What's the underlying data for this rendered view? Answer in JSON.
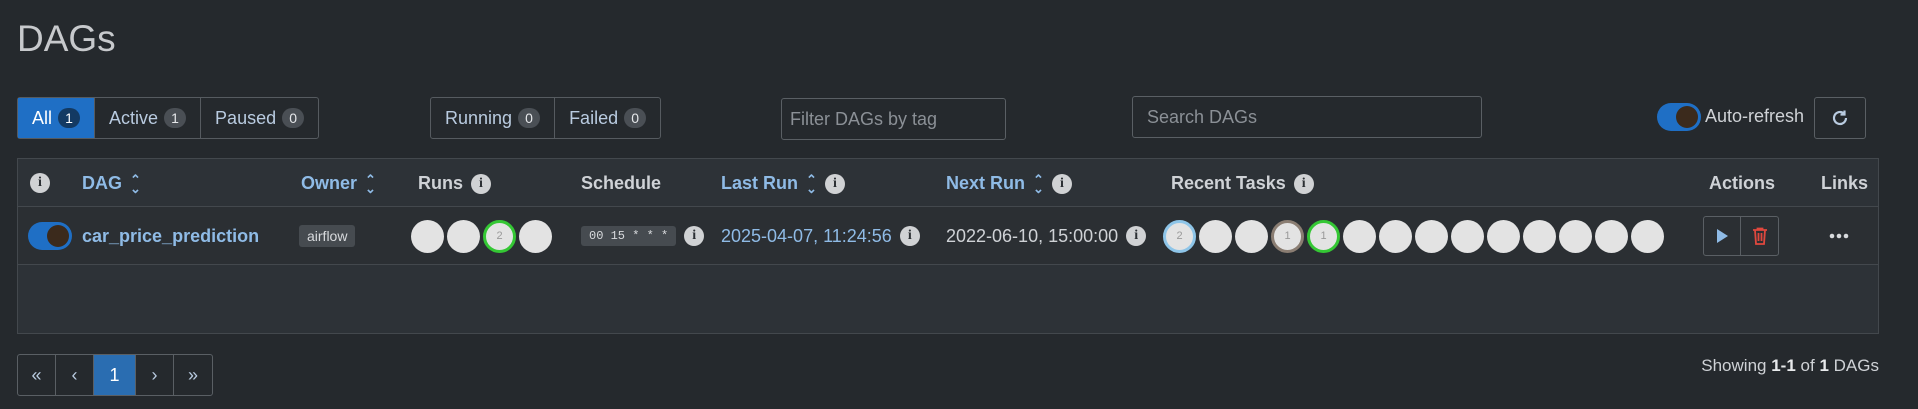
{
  "page": {
    "title": "DAGs"
  },
  "filters": {
    "status": [
      {
        "label": "All",
        "count": "1"
      },
      {
        "label": "Active",
        "count": "1"
      },
      {
        "label": "Paused",
        "count": "0"
      }
    ],
    "state": [
      {
        "label": "Running",
        "count": "0"
      },
      {
        "label": "Failed",
        "count": "0"
      }
    ],
    "tag_placeholder": "Filter DAGs by tag",
    "search_placeholder": "Search DAGs",
    "auto_refresh_label": "Auto-refresh"
  },
  "table": {
    "headers": {
      "dag": "DAG",
      "owner": "Owner",
      "runs": "Runs",
      "schedule": "Schedule",
      "last_run": "Last Run",
      "next_run": "Next Run",
      "recent_tasks": "Recent Tasks",
      "actions": "Actions",
      "links": "Links"
    },
    "rows": [
      {
        "dag_id": "car_price_prediction",
        "owner": "airflow",
        "schedule": "00 15 * * *",
        "last_run": "2025-04-07, 11:24:56",
        "next_run": "2022-06-10, 15:00:00",
        "runs": [
          {
            "count": "",
            "border": ""
          },
          {
            "count": "",
            "border": ""
          },
          {
            "count": "2",
            "border": "#34c734"
          },
          {
            "count": "",
            "border": ""
          }
        ],
        "recent_tasks": [
          {
            "count": "2",
            "border": "#8ec5e8"
          },
          {
            "count": "",
            "border": ""
          },
          {
            "count": "",
            "border": ""
          },
          {
            "count": "1",
            "border": "#8a7d72"
          },
          {
            "count": "1",
            "border": "#34c734"
          },
          {
            "count": "",
            "border": ""
          },
          {
            "count": "",
            "border": ""
          },
          {
            "count": "",
            "border": ""
          },
          {
            "count": "",
            "border": ""
          },
          {
            "count": "",
            "border": ""
          },
          {
            "count": "",
            "border": ""
          },
          {
            "count": "",
            "border": ""
          },
          {
            "count": "",
            "border": ""
          },
          {
            "count": "",
            "border": ""
          }
        ]
      }
    ]
  },
  "pagination": {
    "first": "«",
    "prev": "‹",
    "current": "1",
    "next": "›",
    "last": "»"
  },
  "footer": {
    "showing_prefix": "Showing",
    "range": "1-1",
    "of": "of",
    "total": "1",
    "suffix": "DAGs"
  },
  "colors": {
    "accent": "#1f6fc5",
    "link": "#8fbbe6",
    "success": "#34c734",
    "delete": "#e0483e"
  },
  "icons": {
    "info": "info-icon",
    "sort": "sort-icon",
    "refresh": "refresh-icon",
    "play": "play-icon",
    "delete": "trash-icon",
    "more": "more-icon"
  }
}
